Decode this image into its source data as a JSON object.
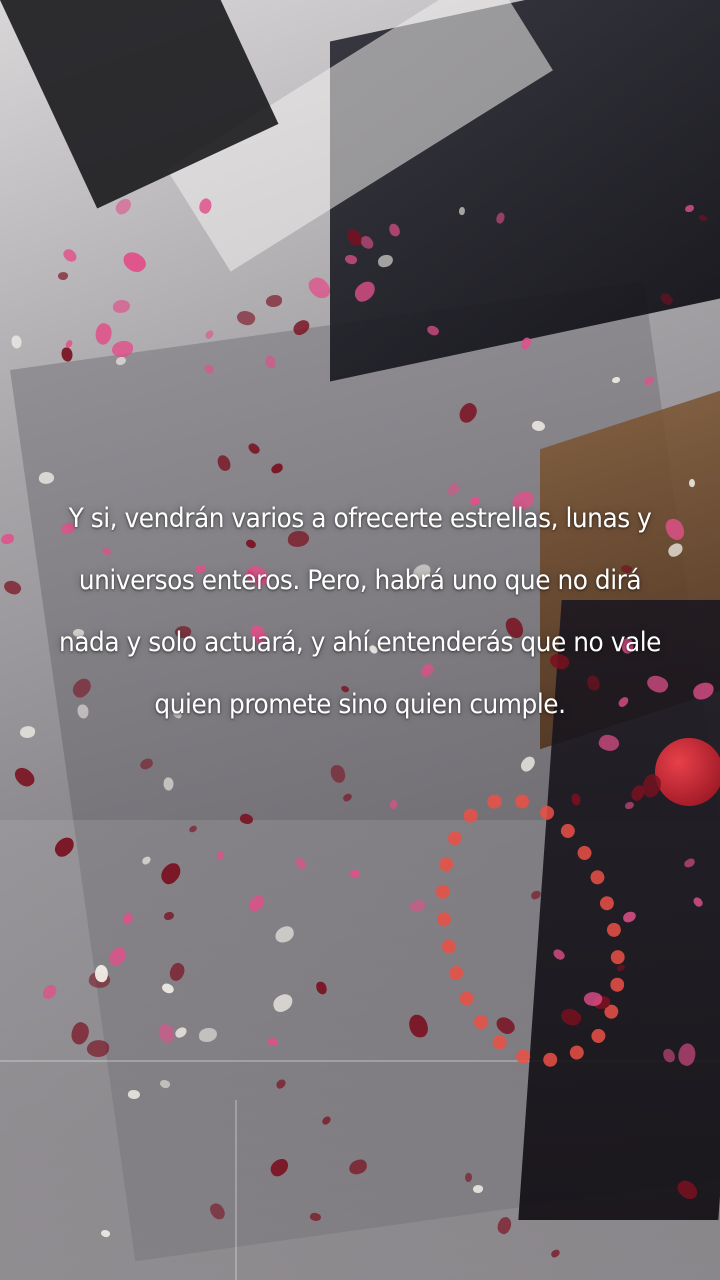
{
  "caption": "Y si, vendrán varios a ofrecerte estrellas, lunas y universos enteros. Pero, habrá uno que no dirá nada y solo actuará, y ahí entenderás que no vale quien promete sino quien cumple.",
  "colors": {
    "text": "#ffffff",
    "petal_dark": "#7a1020",
    "petal_pink": "#e0508a",
    "petal_white": "#f2efe8",
    "heart": "#eb5046"
  }
}
